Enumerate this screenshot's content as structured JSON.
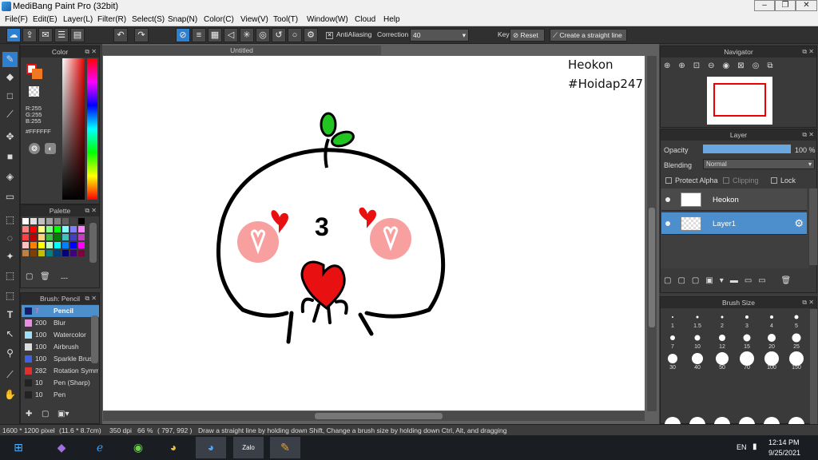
{
  "window": {
    "title": "MediBang Paint Pro (32bit)",
    "min": "–",
    "max": "❐",
    "close": "✕"
  },
  "menu": [
    "File(F)",
    "Edit(E)",
    "Layer(L)",
    "Filter(R)",
    "Select(S)",
    "Snap(N)",
    "Color(C)",
    "View(V)",
    "Tool(T)",
    "Window(W)",
    "Cloud",
    "Help"
  ],
  "toolbar": {
    "antialiasing": "AntiAliasing",
    "correction_label": "Correction",
    "correction_value": "40",
    "key_label": "Key",
    "reset_label": "Reset",
    "straight_label": "Create a straight line"
  },
  "color_panel": {
    "title": "Color",
    "r": "R:255",
    "g": "G:255",
    "b": "B:255",
    "hex": "#FFFFFF"
  },
  "palette_panel": {
    "title": "Palette",
    "footer": "---"
  },
  "brush_panel": {
    "title": "Brush: Pencil",
    "items": [
      {
        "num": "7",
        "name": "Pencil",
        "color": "#1a1a6a"
      },
      {
        "num": "200",
        "name": "Blur",
        "color": "#e890e0"
      },
      {
        "num": "100",
        "name": "Watercolor",
        "color": "#9de0f8"
      },
      {
        "num": "100",
        "name": "Airbrush",
        "color": "#dddddd"
      },
      {
        "num": "100",
        "name": "Sparkle Brush",
        "color": "#4060e8"
      },
      {
        "num": "282",
        "name": "Rotation Symmetry",
        "color": "#e03030"
      },
      {
        "num": "10",
        "name": "Pen (Sharp)",
        "color": "#222222"
      },
      {
        "num": "10",
        "name": "Pen",
        "color": "#222222"
      }
    ]
  },
  "document": {
    "tab": "Untitled",
    "canvas_text_1": "Heokon",
    "canvas_text_2": "#Hoidap247",
    "face_number": "3"
  },
  "navigator": {
    "title": "Navigator"
  },
  "layer_panel": {
    "title": "Layer",
    "opacity_label": "Opacity",
    "opacity_value": "100 %",
    "opacity_fraction": 1.0,
    "blending_label": "Blending",
    "blending_value": "Normal",
    "protect_alpha": "Protect Alpha",
    "clipping": "Clipping",
    "lock": "Lock",
    "layers": [
      {
        "name": "Heokon",
        "selected": false
      },
      {
        "name": "Layer1",
        "selected": true
      }
    ]
  },
  "brush_size": {
    "title": "Brush Size",
    "sizes": [
      "1",
      "1.5",
      "2",
      "3",
      "4",
      "5",
      "7",
      "10",
      "12",
      "15",
      "20",
      "25",
      "30",
      "40",
      "50",
      "70",
      "100",
      "150"
    ]
  },
  "status": {
    "size": "1600 * 1200 pixel",
    "cm": "(11.6 * 8.7cm)",
    "dpi": "350 dpi",
    "zoom": "66 %",
    "coords": "( 797, 992 )",
    "hint": "Draw a straight line by holding down Shift, Change a brush size by holding down Ctrl, Alt, and dragging"
  },
  "taskbar": {
    "lang": "EN",
    "time": "12:14 PM",
    "date": "9/25/2021",
    "zalo": "Zalo"
  },
  "colors": {
    "accent": "#2f7fd0",
    "heart": "#e81010",
    "sprout": "#22c422",
    "cheek": "#f8a0a0"
  }
}
